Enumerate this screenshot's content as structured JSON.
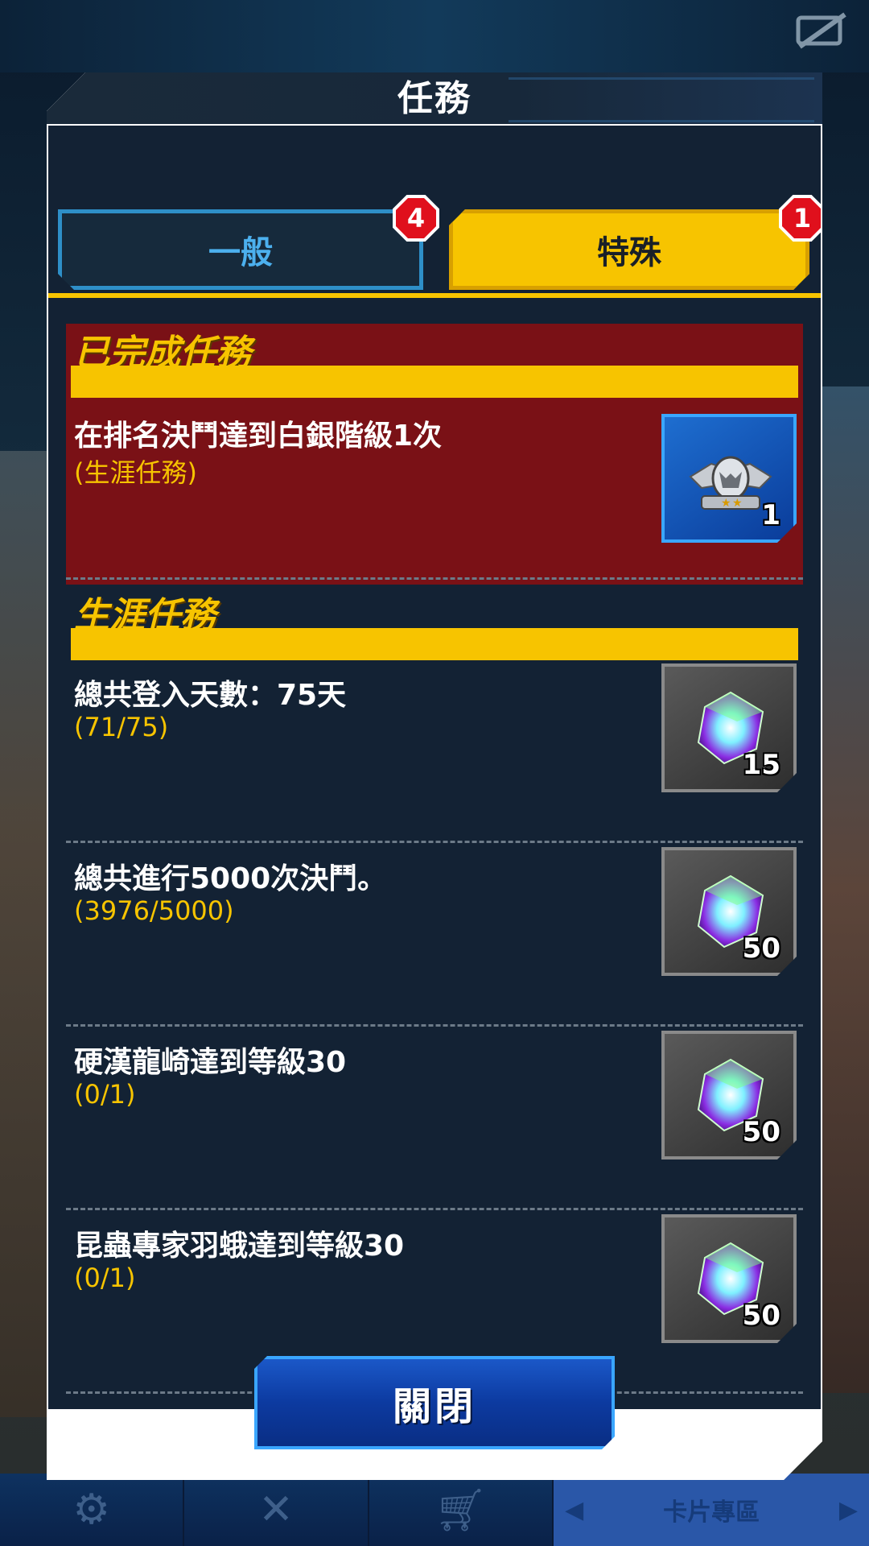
{
  "dialog": {
    "title": "任務",
    "close_label": "關閉"
  },
  "tabs": [
    {
      "label": "一般",
      "badge": "4",
      "selected": false
    },
    {
      "label": "特殊",
      "badge": "1",
      "selected": true
    }
  ],
  "completed_section": {
    "title": "已完成任務",
    "quest": {
      "text": "在排名決鬥達到白銀階級1次",
      "sub": "(生涯任務)",
      "reward_icon": "silver-rank-emblem",
      "reward_count": "1"
    }
  },
  "career_section": {
    "title": "生涯任務",
    "quests": [
      {
        "text": "總共登入天數：75天",
        "sub": "(71/75)",
        "reward_icon": "gem-icon",
        "reward_count": "15"
      },
      {
        "text": "總共進行5000次決鬥。",
        "sub": "(3976/5000)",
        "reward_icon": "gem-icon",
        "reward_count": "50"
      },
      {
        "text": "硬漢龍崎達到等級30",
        "sub": "(0/1)",
        "reward_icon": "gem-icon",
        "reward_count": "50"
      },
      {
        "text": "昆蟲專家羽蛾達到等級30",
        "sub": "(0/1)",
        "reward_icon": "gem-icon",
        "reward_count": "50"
      }
    ]
  },
  "bottom_nav": {
    "card_shop_label": "卡片專區"
  },
  "colors": {
    "accent_yellow": "#f7c400",
    "completed_bg": "#7a1116",
    "panel_bg": "#132234",
    "badge_red": "#e0101c",
    "button_blue": "#0c3aa0"
  }
}
